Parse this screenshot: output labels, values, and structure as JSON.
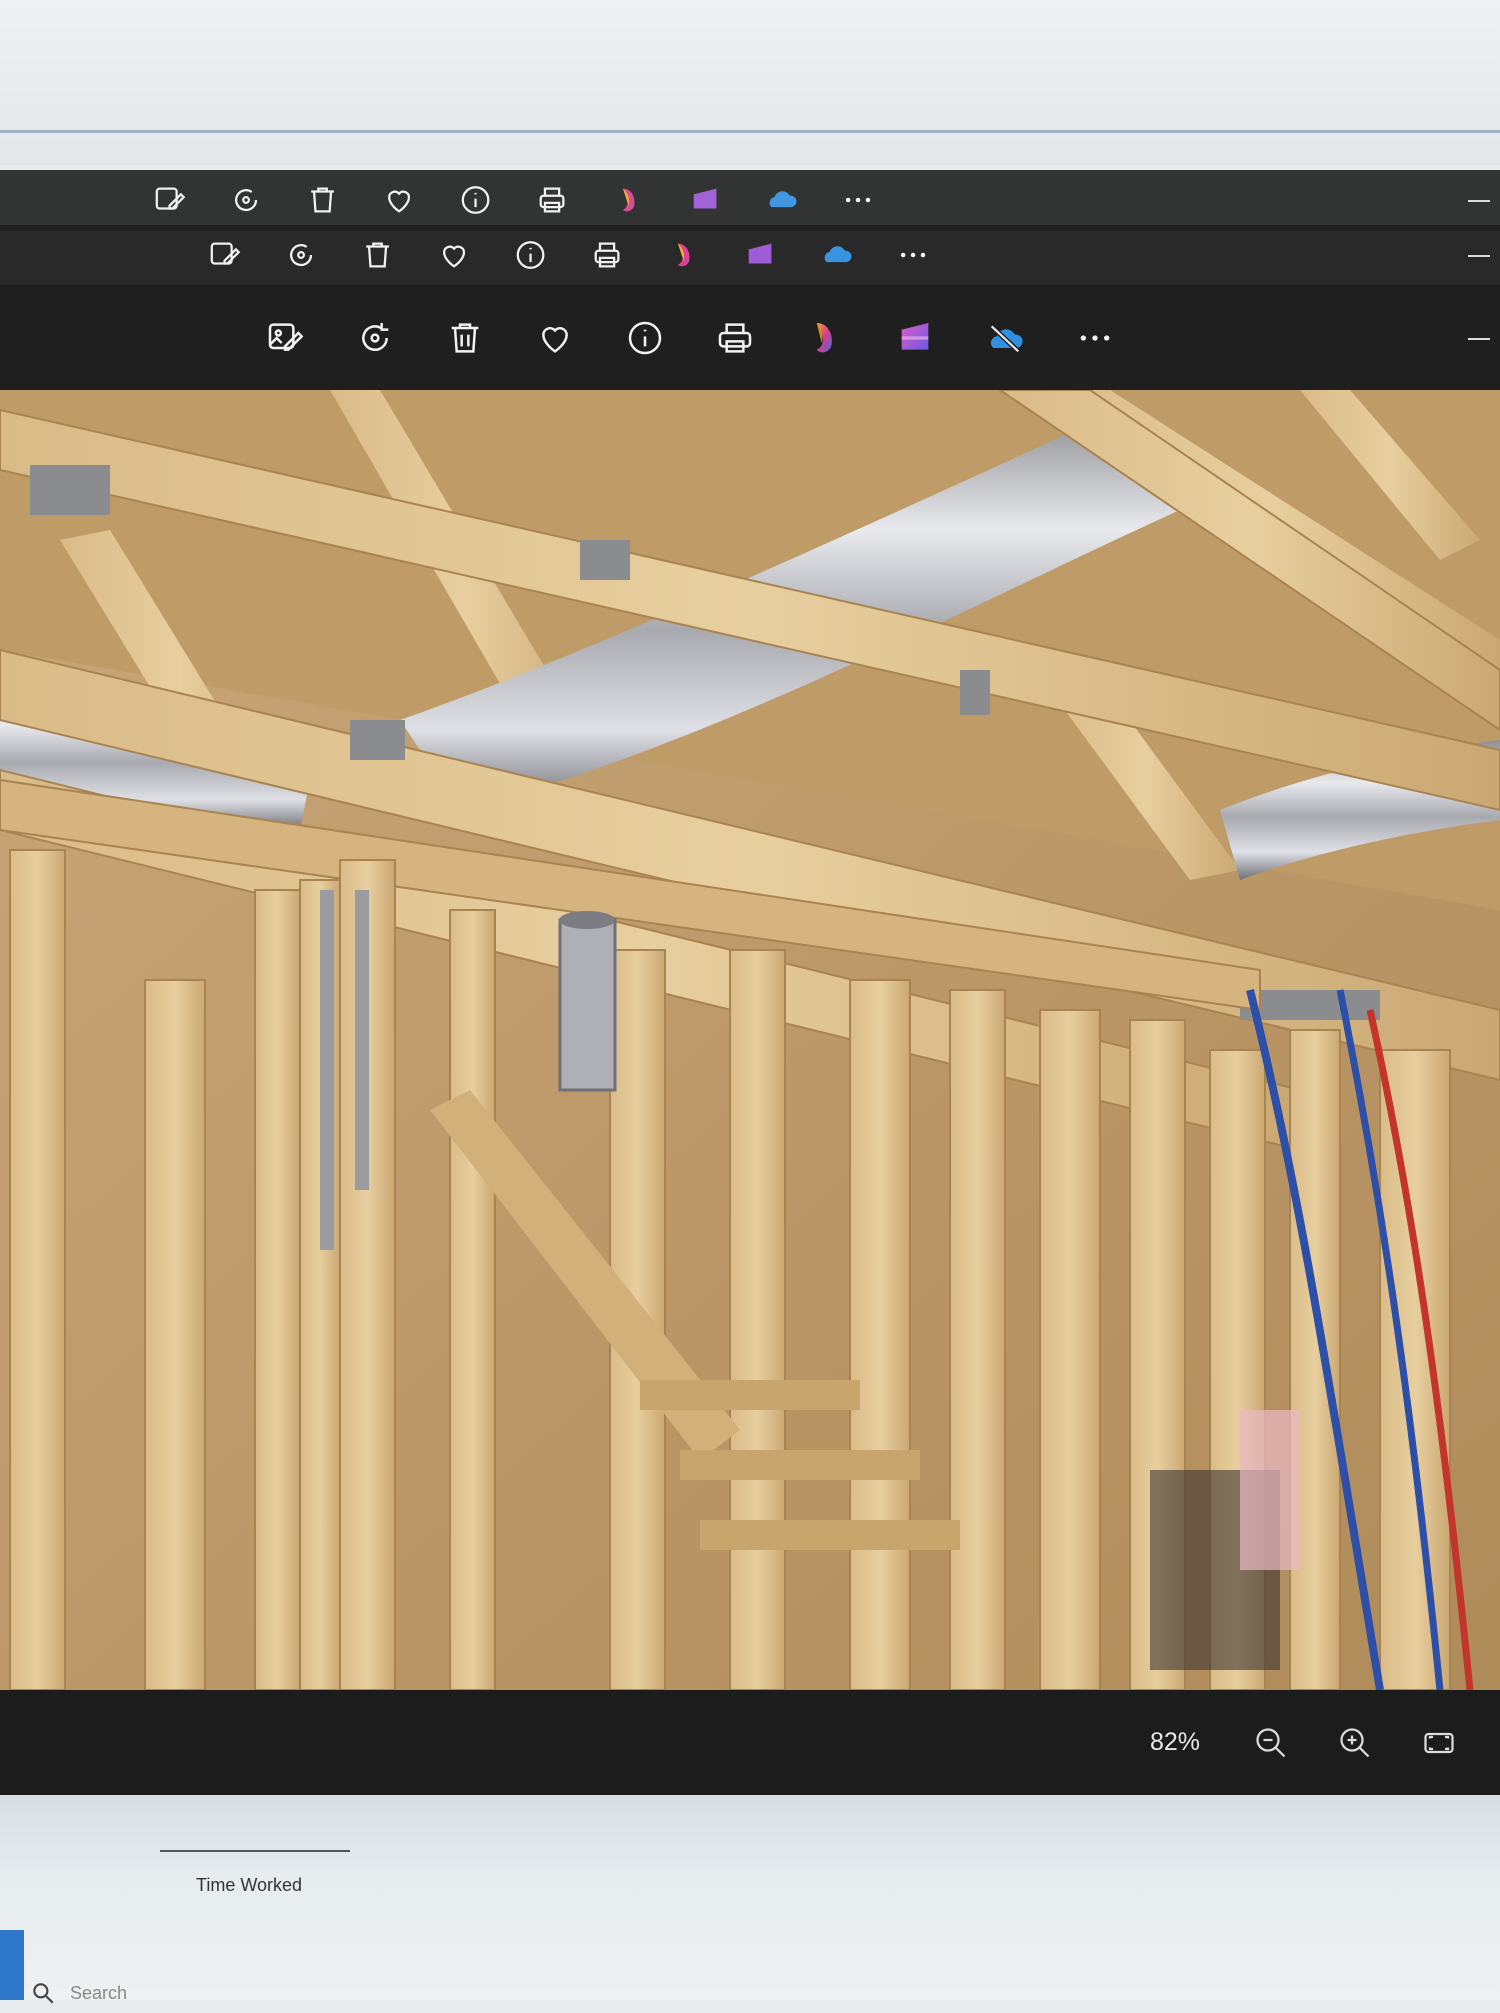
{
  "viewer": {
    "toolbar": {
      "buttons": [
        {
          "label": "Edit image",
          "icon": "edit-image-icon"
        },
        {
          "label": "Rotate",
          "icon": "rotate-icon"
        },
        {
          "label": "Delete",
          "icon": "trash-icon"
        },
        {
          "label": "Favorite",
          "icon": "heart-icon"
        },
        {
          "label": "Info",
          "icon": "info-icon"
        },
        {
          "label": "Print",
          "icon": "print-icon"
        },
        {
          "label": "Copilot",
          "icon": "copilot-icon"
        },
        {
          "label": "Clipchamp",
          "icon": "clipchamp-icon"
        },
        {
          "label": "OneDrive (not signed in)",
          "icon": "onedrive-off-icon"
        },
        {
          "label": "More options",
          "icon": "more-icon"
        }
      ]
    },
    "status": {
      "zoom": "82%",
      "zoom_out_icon": "zoom-out-icon",
      "zoom_in_icon": "zoom-in-icon",
      "fit_icon": "fit-to-window-icon"
    },
    "colors": {
      "toolbar_bg": "#1f1f1f",
      "copilot_gradient": [
        "#f6a623",
        "#d83b8f",
        "#3a6fe0"
      ],
      "clipchamp_gradient": [
        "#c94fd0",
        "#7b5bdc"
      ],
      "onedrive_color": "#2f8fe0"
    }
  },
  "background_app": {
    "field_label": "Time Worked",
    "search_placeholder": "Search"
  }
}
